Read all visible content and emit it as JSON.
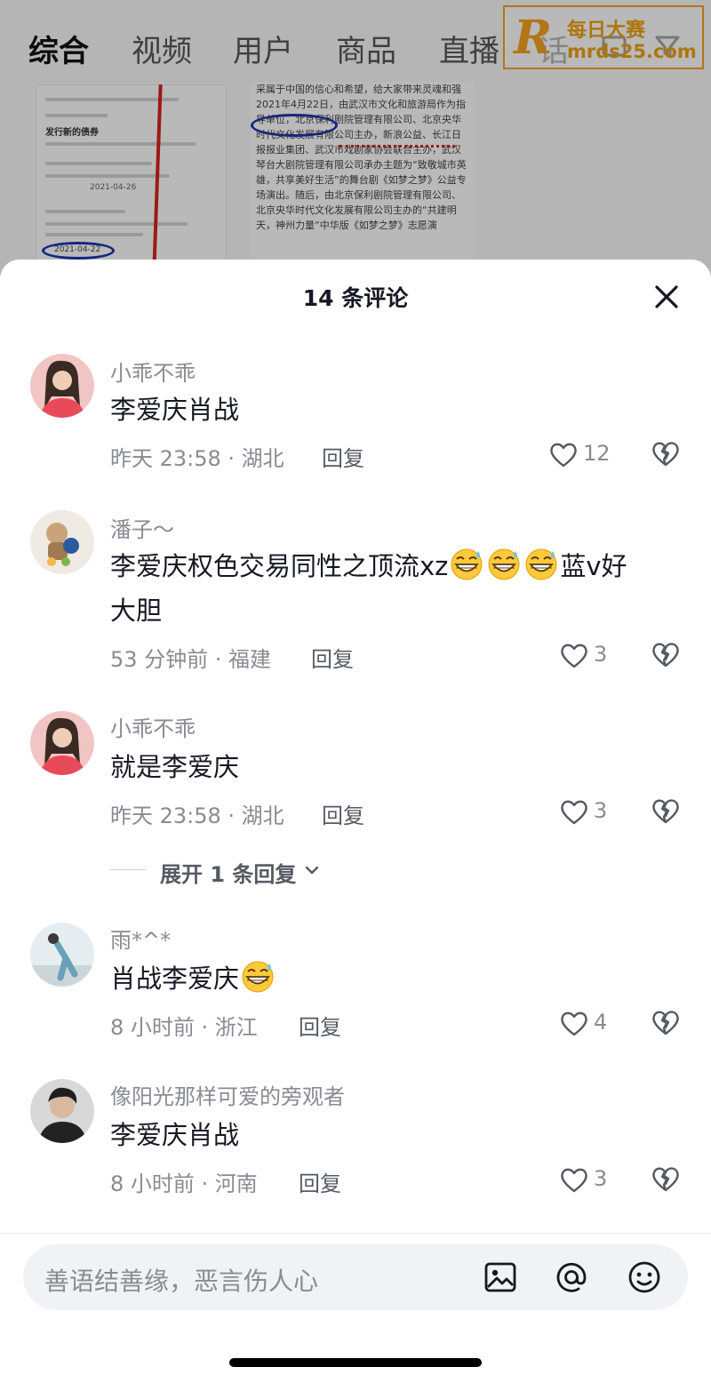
{
  "top_tabs": [
    "综合",
    "视频",
    "用户",
    "商品",
    "直播",
    "话"
  ],
  "watermark": {
    "title": "每日大赛",
    "url": "mrds25.com"
  },
  "background_doc": {
    "left_lines": [
      "发行新的债券",
      "2021-04-26",
      "2021-04-22"
    ],
    "right_text": "采属于中国的信心和希望，给大家带来灵魂和强 2021年4月22日，由武汉市文化和旅游局作为指导单位，北京保利剧院管理有限公司、北京央华时代文化发展有限公司主办，新浪公益、长江日报报业集团、武汉市戏剧家协会联合主办，武汉琴台大剧院管理有限公司承办主题为“致敬城市英雄，共享美好生活”的舞台剧《如梦之梦》公益专场演出。随后，由北京保利剧院管理有限公司、北京央华时代文化发展有限公司主办的“共建明天，神州力量”中华版《如梦之梦》志愿演",
    "right_date_highlight": "2021年4月22日"
  },
  "sheet": {
    "title": "14 条评论"
  },
  "comments": [
    {
      "username": "小乖不乖",
      "text": "李爱庆肖战",
      "time": "昨天 23:58 · 湖北",
      "reply": "回复",
      "likes": "12"
    },
    {
      "username": "潘子～",
      "text_before": "李爱庆权色交易同性之顶流xz",
      "text_after": "蓝v好",
      "text_line2": "大胆",
      "time": "53 分钟前 · 福建",
      "reply": "回复",
      "likes": "3"
    },
    {
      "username": "小乖不乖",
      "text": "就是李爱庆",
      "time": "昨天 23:58 · 湖北",
      "reply": "回复",
      "likes": "3",
      "expand": "展开 1 条回复"
    },
    {
      "username": "雨*^*",
      "text": "肖战李爱庆",
      "time": "8 小时前 · 浙江",
      "reply": "回复",
      "likes": "4"
    },
    {
      "username": "像阳光那样可爱的旁观者",
      "text": "李爱庆肖战",
      "time": "8 小时前 · 河南",
      "reply": "回复",
      "likes": "3"
    }
  ],
  "input": {
    "placeholder": "善语结善缘，恶言伤人心"
  },
  "icons": [
    "close-icon",
    "heart-icon",
    "broken-heart-icon",
    "image-icon",
    "at-icon",
    "emoji-icon",
    "chevron-down-icon",
    "grin-sweat-emoji"
  ],
  "colors": {
    "text": "#161823",
    "secondary": "#8a8b91",
    "input_bg": "#f1f2f5",
    "watermark": "#f0a020"
  }
}
